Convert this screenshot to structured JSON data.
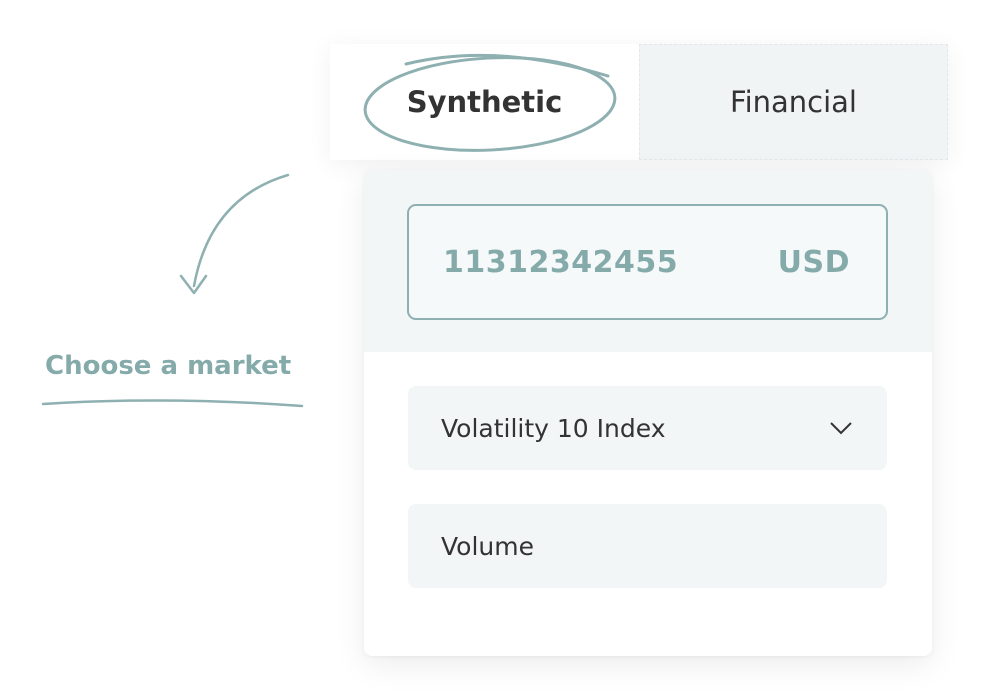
{
  "tabs": [
    {
      "label": "Synthetic",
      "active": true
    },
    {
      "label": "Financial",
      "active": false
    }
  ],
  "account": {
    "balance": "11312342455",
    "currency": "USD"
  },
  "market_select": {
    "value": "Volatility 10 Index"
  },
  "volume_field": {
    "placeholder": "Volume"
  },
  "annotation": {
    "text": "Choose a market"
  },
  "colors": {
    "accent": "#85aaaa",
    "border": "#8eb0b1",
    "panel_bg": "#f2f6f6",
    "text": "#333333"
  },
  "icons": {
    "dropdown": "chevron-down-icon",
    "annotation_arrow": "curved-arrow-icon"
  }
}
